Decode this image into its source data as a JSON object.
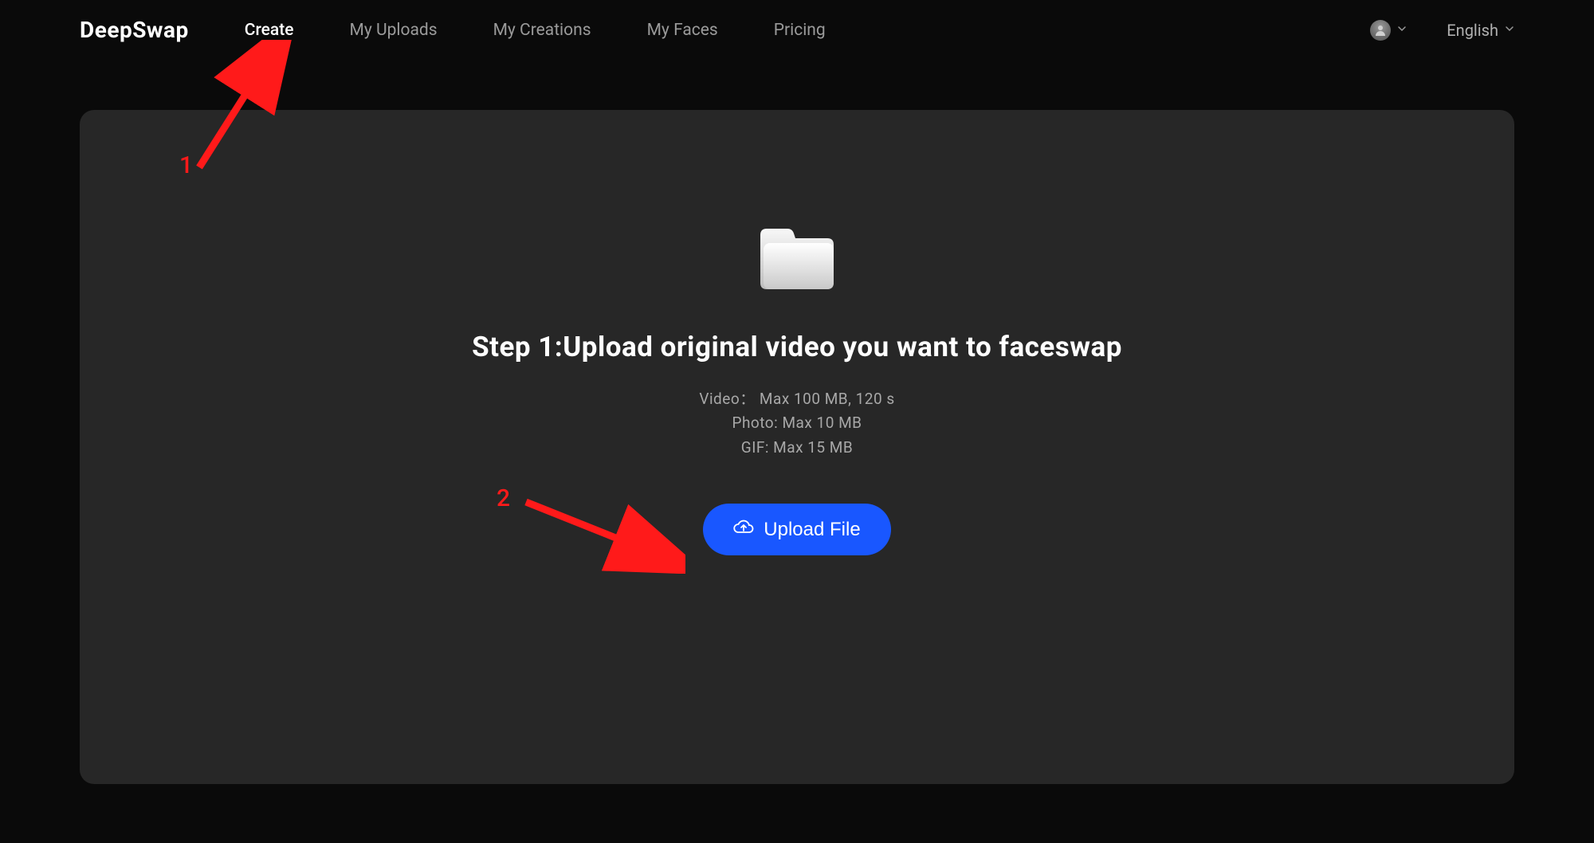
{
  "brand": "DeepSwap",
  "nav": {
    "items": [
      {
        "label": "Create",
        "active": true
      },
      {
        "label": "My Uploads",
        "active": false
      },
      {
        "label": "My Creations",
        "active": false
      },
      {
        "label": "My Faces",
        "active": false
      },
      {
        "label": "Pricing",
        "active": false
      }
    ]
  },
  "header": {
    "language": "English"
  },
  "main": {
    "heading": "Step 1:Upload original video you want to faceswap",
    "limits": {
      "video": "Video： Max 100 MB, 120 s",
      "photo": "Photo: Max 10 MB",
      "gif": "GIF: Max 15 MB"
    },
    "upload_label": "Upload File"
  },
  "annotations": {
    "label1": "1",
    "label2": "2"
  },
  "colors": {
    "accent": "#1957ff",
    "annotation": "#ff1a1a",
    "panel": "#272727",
    "bg": "#0a0a0a"
  }
}
